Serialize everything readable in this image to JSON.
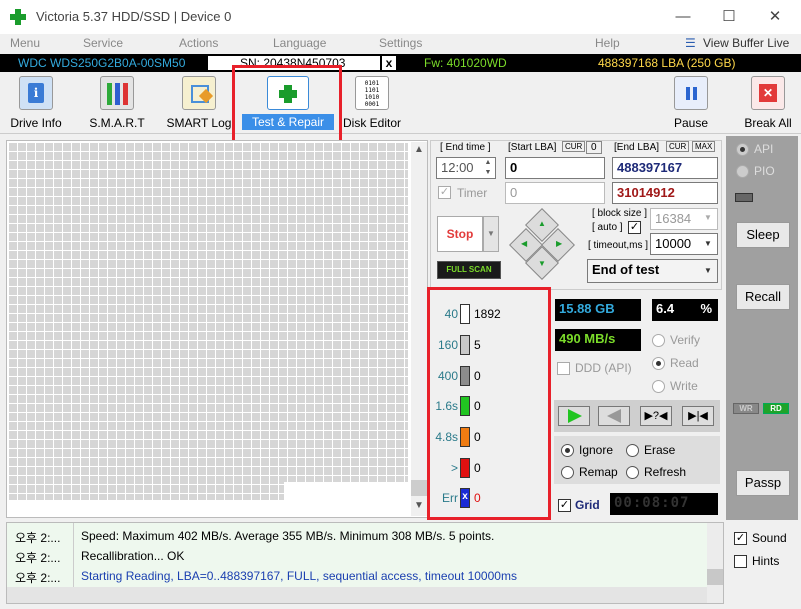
{
  "window": {
    "title": "Victoria 5.37 HDD/SSD | Device 0",
    "minimize": "—",
    "maximize": "☐",
    "close": "✕"
  },
  "menu": [
    "Menu",
    "Service",
    "Actions",
    "Language",
    "Settings",
    "Help"
  ],
  "view_buffer_live": "View Buffer Live",
  "drive": {
    "model": "WDC  WDS250G2B0A-00SM50",
    "serial": "SN: 20438N450703",
    "x_label": "x",
    "firmware": "Fw: 401020WD",
    "lba_size": "488397168 LBA (250 GB)"
  },
  "toolbar": {
    "drive_info": "Drive Info",
    "smart": "S.M.A.R.T",
    "smart_log": "SMART Log",
    "test_repair": "Test & Repair",
    "disk_editor": "Disk Editor",
    "pause": "Pause",
    "break_all": "Break All"
  },
  "test": {
    "end_time_label": "[ End time ]",
    "start_lba_label": "[Start LBA]",
    "cur_label": "CUR",
    "cur_value": "0",
    "end_lba_label": "[End LBA]",
    "max_label": "MAX",
    "end_time_value": "12:00",
    "start_lba_value": "0",
    "end_lba_value": "488397167",
    "timer_label": "Timer",
    "timer_value": "0",
    "current_lba": "31014912",
    "block_size_label": "[ block size ]",
    "auto_label": "[ auto ]",
    "block_size_value": "16384",
    "timeout_label": "[ timeout,ms ]",
    "timeout_value": "10000",
    "stop_label": "Stop",
    "full_scan_label": "FULL SCAN",
    "end_of_test": "End of test"
  },
  "legend": [
    {
      "label": "40",
      "count": "1892",
      "color": "#ffffff"
    },
    {
      "label": "160",
      "count": "5",
      "color": "#c8c8c8"
    },
    {
      "label": "400",
      "count": "0",
      "color": "#8c8c8c"
    },
    {
      "label": "1.6s",
      "count": "0",
      "color": "#21c521"
    },
    {
      "label": "4.8s",
      "count": "0",
      "color": "#f07c12"
    },
    {
      "label": ">",
      "count": "0",
      "color": "#e01010"
    },
    {
      "label": "Err",
      "count": "0",
      "color": "#1a2bd6"
    }
  ],
  "err_icon": "x",
  "stats": {
    "size": "15.88 GB",
    "percent": "6.4",
    "percent_sign": "%",
    "speed": "490 MB/s",
    "ddd_label": "DDD (API)",
    "verify": "Verify",
    "read": "Read",
    "write": "Write"
  },
  "repair": {
    "ignore": "Ignore",
    "erase": "Erase",
    "remap": "Remap",
    "refresh": "Refresh",
    "grid": "Grid",
    "timer": "00:08:07"
  },
  "right": {
    "api": "API",
    "pio": "PIO",
    "sleep": "Sleep",
    "recall": "Recall",
    "wr": "WR",
    "rd": "RD",
    "passp": "Passp",
    "sound": "Sound",
    "hints": "Hints"
  },
  "log": [
    {
      "time": "오후 2:...",
      "msg": "Speed: Maximum 402 MB/s. Average 355 MB/s. Minimum 308 MB/s. 5 points.",
      "color": "#000000"
    },
    {
      "time": "오후 2:...",
      "msg": "Recallibration... OK",
      "color": "#000000"
    },
    {
      "time": "오후 2:...",
      "msg": "Starting Reading, LBA=0..488397167, FULL, sequential access, timeout 10000ms",
      "color": "#1a3fb0"
    }
  ],
  "colors": {
    "accent_red": "#e8202a",
    "selected_tab": "#3b8fe8",
    "brand_green": "#1a9c2c"
  }
}
